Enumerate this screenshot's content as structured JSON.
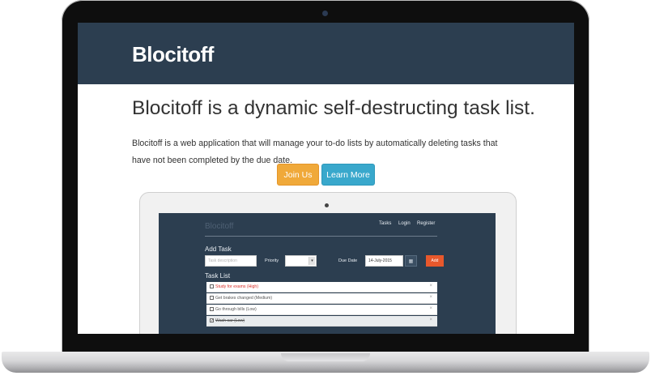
{
  "hero": {
    "brand": "Blocitoff",
    "headline": "Blocitoff is a dynamic self-destructing task list.",
    "lead": "Blocitoff is a web application that will manage your to-do lists by automatically deleting tasks that have not been completed by the due date.",
    "join_label": "Join Us",
    "learn_label": "Learn More"
  },
  "preview": {
    "brand": "Blocitoff",
    "nav": [
      "Tasks",
      "Login",
      "Register"
    ],
    "add_task_title": "Add Task",
    "description_placeholder": "Task description",
    "priority_label": "Priority",
    "due_date_label": "Due Date",
    "due_date_value": "14-July-2015",
    "add_button": "Add",
    "task_list_title": "Task List",
    "tasks": [
      {
        "text": "Study for exams (High)",
        "checked": false
      },
      {
        "text": "Get brakes changed (Medium)",
        "checked": false
      },
      {
        "text": "Go through bills (Low)",
        "checked": false
      },
      {
        "text": "Wash car (Low)",
        "checked": true
      }
    ],
    "delete_glyph": "×"
  },
  "colors": {
    "header": "#2c3e50",
    "join": "#f0a93a",
    "learn": "#39a8cc",
    "add": "#e8582c",
    "high_priority": "#d9302a"
  }
}
